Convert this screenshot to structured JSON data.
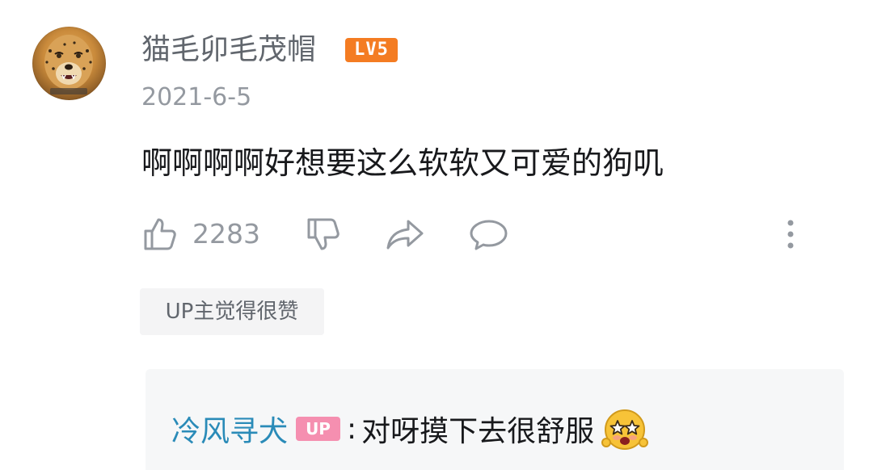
{
  "comment": {
    "username": "猫毛卯毛茂帽",
    "level": "LV5",
    "date": "2021-6-5",
    "text": "啊啊啊啊好想要这么软软又可爱的狗叽",
    "like_count": "2283"
  },
  "badges": {
    "up_liked": "UP主觉得很赞"
  },
  "reply": {
    "author": "冷风寻犬",
    "up_tag": "UP",
    "colon": ":",
    "text": "对呀摸下去很舒服"
  },
  "icons": {
    "like": "thumbs-up-icon",
    "dislike": "thumbs-down-icon",
    "share": "share-icon",
    "reply": "comment-icon",
    "more": "more-vertical-icon",
    "emoji": "starry-eyes-emoji"
  },
  "colors": {
    "level_badge": "#f47c22",
    "up_tag": "#f58fb0",
    "reply_author": "#2a8bb8",
    "secondary_text": "#9499a0"
  }
}
